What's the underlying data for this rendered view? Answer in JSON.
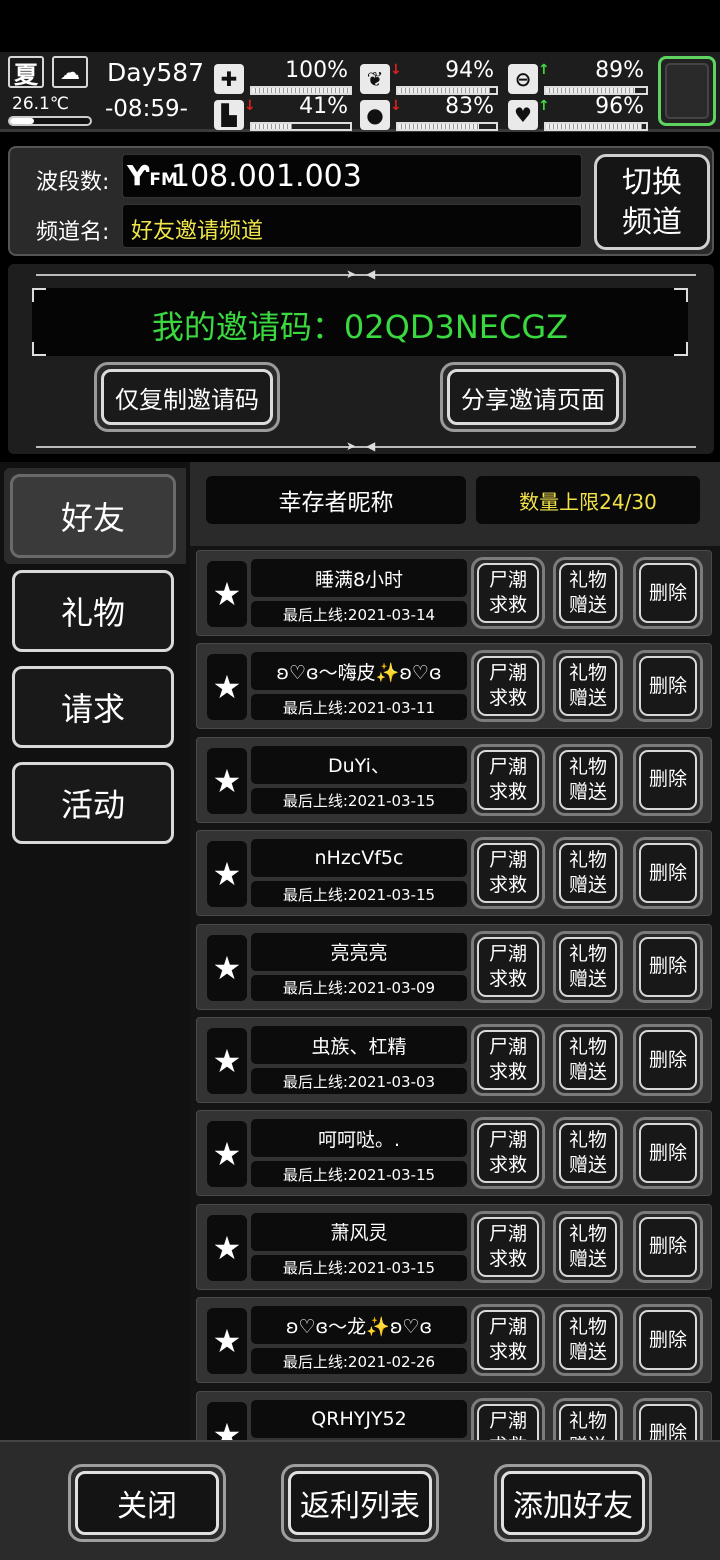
{
  "hud": {
    "season": "夏",
    "weather_icon": "cloud-icon",
    "temperature": "26.1℃",
    "temperature_level": 0.3,
    "day": "Day587",
    "time": "-08:59-",
    "stats": [
      {
        "icon": "health-kit-icon",
        "value": "100%",
        "trend": "",
        "level": 1.0
      },
      {
        "icon": "stomach-icon",
        "value": "94%",
        "trend": "down",
        "level": 0.94
      },
      {
        "icon": "capsule-icon",
        "value": "89%",
        "trend": "up",
        "level": 0.89
      },
      {
        "icon": "boot-icon",
        "value": "41%",
        "trend": "down",
        "level": 0.41
      },
      {
        "icon": "water-drop-icon",
        "value": "83%",
        "trend": "down",
        "level": 0.83
      },
      {
        "icon": "heart-icon",
        "value": "96%",
        "trend": "up",
        "level": 0.96
      }
    ]
  },
  "radio": {
    "band_label": "波段数:",
    "frequency": "108.001.003",
    "fm_icon": "antenna-fm-icon",
    "fm_text": "FM",
    "channel_label": "频道名:",
    "channel_name": "好友邀请频道",
    "switch_button": "切换\n频道"
  },
  "invite": {
    "code_text": "我的邀请码：02QD3NECGZ",
    "copy_button": "仅复制邀请码",
    "share_button": "分享邀请页面"
  },
  "tabs": [
    "好友",
    "礼物",
    "请求",
    "活动"
  ],
  "list_header": {
    "name_col": "幸存者昵称",
    "limit": "数量上限24/30"
  },
  "row_buttons": {
    "rescue": "尸潮\n求救",
    "gift": "礼物\n赠送",
    "delete": "删除"
  },
  "friends": [
    {
      "name": "睡满8小时",
      "last_online": "最后上线:2021-03-14"
    },
    {
      "name": "ʚ♡ɞ～嗨皮✨ʚ♡ɞ",
      "last_online": "最后上线:2021-03-11"
    },
    {
      "name": "DuYi、",
      "last_online": "最后上线:2021-03-15"
    },
    {
      "name": "nHzcVf5c",
      "last_online": "最后上线:2021-03-15"
    },
    {
      "name": "亮亮亮",
      "last_online": "最后上线:2021-03-09"
    },
    {
      "name": "虫族、杠精",
      "last_online": "最后上线:2021-03-03"
    },
    {
      "name": "呵呵哒。.",
      "last_online": "最后上线:2021-03-15"
    },
    {
      "name": "萧风灵",
      "last_online": "最后上线:2021-03-15"
    },
    {
      "name": "ʚ♡ɞ～龙✨ʚ♡ɞ",
      "last_online": "最后上线:2021-02-26"
    },
    {
      "name": "QRHYJY52",
      "last_online": ""
    }
  ],
  "bottom": {
    "close": "关闭",
    "rebate": "返利列表",
    "add_friend": "添加好友"
  },
  "colors": {
    "invite_code": "#39d93f",
    "channel_name": "#f0e64a",
    "limit_text": "#f2e24a",
    "slot_border": "#5fd35f",
    "trend_up": "#3ddc3d",
    "trend_down": "#e02020"
  }
}
